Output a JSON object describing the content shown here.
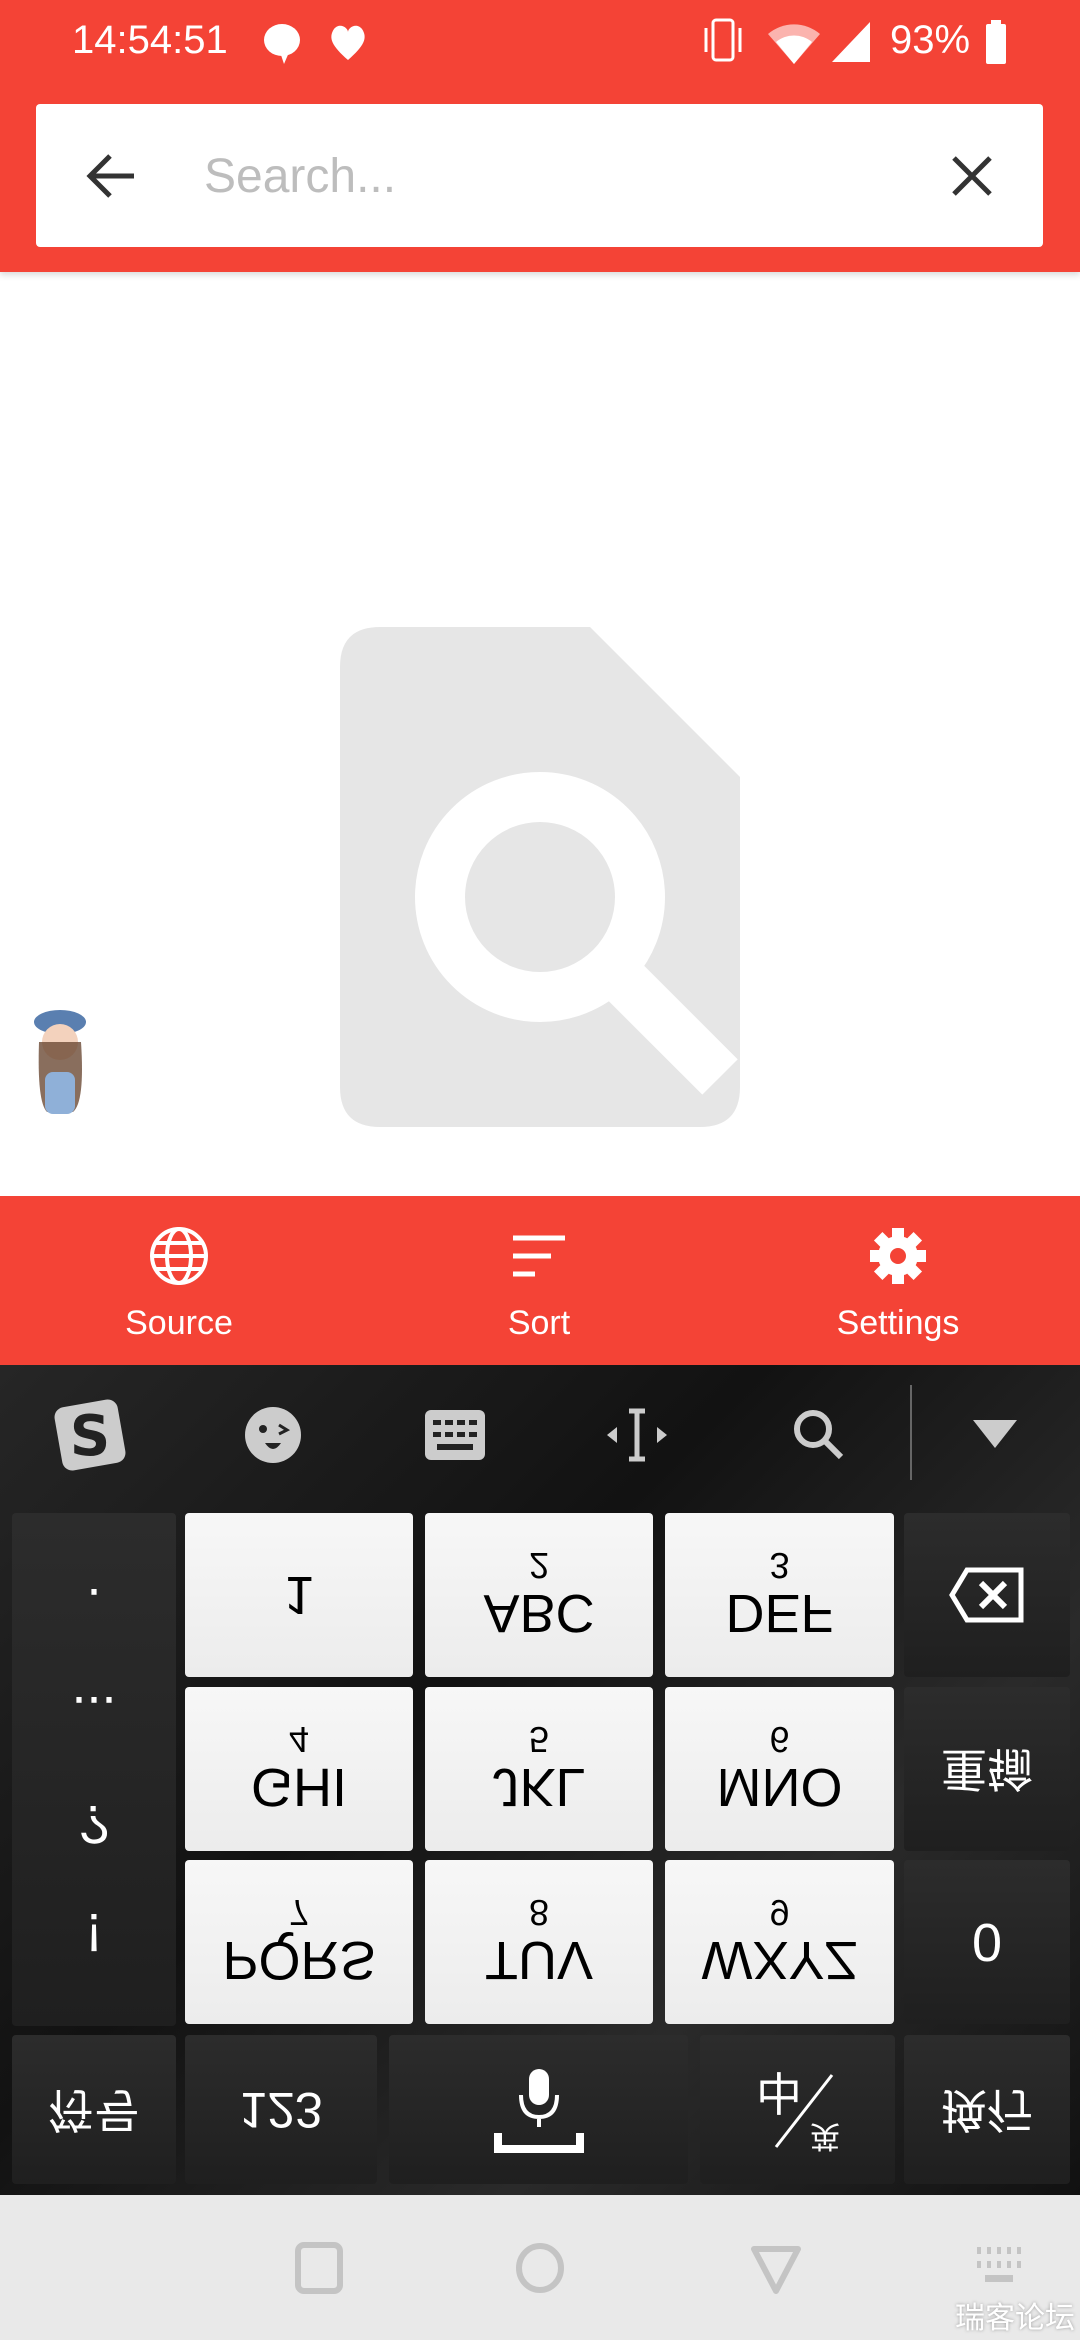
{
  "status_bar": {
    "time": "14:54:51",
    "battery": "93%",
    "icons": [
      "chat-bubble-icon",
      "heart-icon",
      "vibrate-icon",
      "wifi-icon",
      "signal-icon",
      "battery-icon"
    ]
  },
  "search": {
    "placeholder": "Search...",
    "value": ""
  },
  "empty_state": {
    "icon": "file-search-icon"
  },
  "bottom_nav": [
    {
      "label": "Source",
      "icon": "globe-icon"
    },
    {
      "label": "Sort",
      "icon": "sort-icon"
    },
    {
      "label": "Settings",
      "icon": "gear-icon"
    }
  ],
  "keyboard": {
    "toolbar": [
      "sogou-logo-icon",
      "emoji-icon",
      "keyboard-icon",
      "cursor-icon",
      "search-icon",
      "collapse-icon"
    ],
    "punct": [
      ".",
      "...",
      "?",
      "!"
    ],
    "keys": [
      {
        "num": "",
        "letters": "1"
      },
      {
        "num": "2",
        "letters": "ABC"
      },
      {
        "num": "3",
        "letters": "DEF"
      },
      {
        "num": "4",
        "letters": "GHI"
      },
      {
        "num": "5",
        "letters": "JKL"
      },
      {
        "num": "6",
        "letters": "MNO"
      },
      {
        "num": "7",
        "letters": "PQRS"
      },
      {
        "num": "8",
        "letters": "TUV"
      },
      {
        "num": "9",
        "letters": "WXYZ"
      }
    ],
    "retype": "重输",
    "zero": "0",
    "symbols": "符号",
    "num123": "123",
    "lang_zh": "中",
    "lang_en": "英",
    "enter": "换行"
  },
  "accent_color": "#f44336",
  "watermark": "瑞客论坛"
}
